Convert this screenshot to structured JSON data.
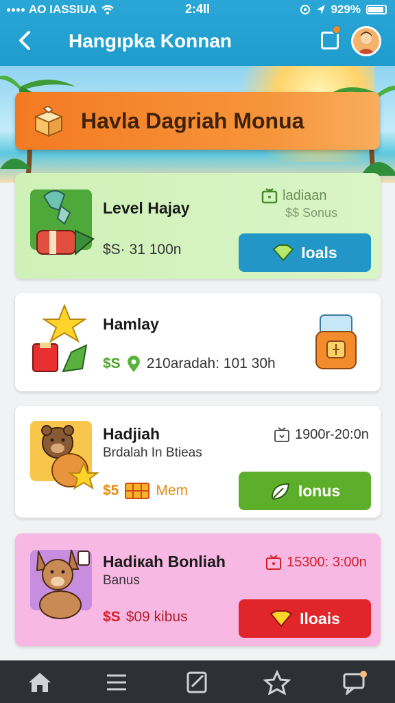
{
  "status": {
    "carrier": "AO IASSIUA",
    "time": "2:4II",
    "battery": "929%"
  },
  "header": {
    "title": "Hangıpka Konnan"
  },
  "banner": {
    "text": "Havla Dagriah Monua"
  },
  "cards": [
    {
      "title": "Level Hajay",
      "price": "$S· 31 100n",
      "side_line1": "ladiaan",
      "side_line2": "$$ Sonus",
      "button": "Ioals"
    },
    {
      "title": "Hamlay",
      "price_symbol": "$S",
      "price_text": "210aradah: 101 30h"
    },
    {
      "title": "Hadjiah",
      "subtitle": "Brdalah In Btieas",
      "side_text": "1900r-20:0n",
      "price_symbol": "$5",
      "price_text": "Mem",
      "button": "Ionus"
    },
    {
      "title": "Hadiкah Bonliah",
      "subtitle": "Banus",
      "side_text": "15300: 3:00n",
      "price_symbol": "$S",
      "price_text": "$09 kibus",
      "button": "Iloais"
    }
  ],
  "colors": {
    "header": "#1f9ccb",
    "banner": "#f47a21",
    "btn_blue": "#2196c7",
    "btn_green": "#5cae2b",
    "btn_red": "#e0262b"
  }
}
